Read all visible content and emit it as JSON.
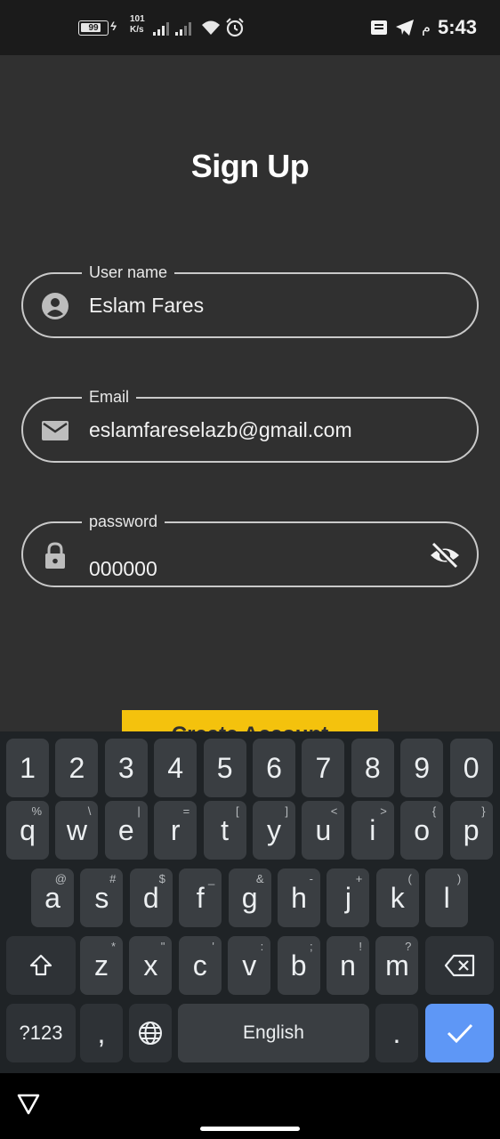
{
  "status_bar": {
    "battery": "99",
    "charge_symbol": "ϟ",
    "speed_value": "101",
    "speed_unit": "K/s",
    "arabic_ampm": "م",
    "time": "5:43"
  },
  "page": {
    "title": "Sign Up"
  },
  "form": {
    "username": {
      "label": "User name",
      "value": "Eslam Fares",
      "icon": "person-icon"
    },
    "email": {
      "label": "Email",
      "value": "eslamfareselazb@gmail.com",
      "icon": "mail-icon"
    },
    "password": {
      "label": "password",
      "value": "000000",
      "icon": "lock-icon",
      "toggle_icon": "eye-off-icon"
    }
  },
  "submit_button": {
    "label": "Create Account",
    "color": "#f4c20d"
  },
  "keyboard": {
    "row_numbers": [
      "1",
      "2",
      "3",
      "4",
      "5",
      "6",
      "7",
      "8",
      "9",
      "0"
    ],
    "row_q": [
      {
        "k": "q",
        "h": "%"
      },
      {
        "k": "w",
        "h": "\\"
      },
      {
        "k": "e",
        "h": "|"
      },
      {
        "k": "r",
        "h": "="
      },
      {
        "k": "t",
        "h": "["
      },
      {
        "k": "y",
        "h": "]"
      },
      {
        "k": "u",
        "h": "<"
      },
      {
        "k": "i",
        "h": ">"
      },
      {
        "k": "o",
        "h": "{"
      },
      {
        "k": "p",
        "h": "}"
      }
    ],
    "row_a": [
      {
        "k": "a",
        "h": "@"
      },
      {
        "k": "s",
        "h": "#"
      },
      {
        "k": "d",
        "h": "$"
      },
      {
        "k": "f",
        "h": "_"
      },
      {
        "k": "g",
        "h": "&"
      },
      {
        "k": "h",
        "h": "-"
      },
      {
        "k": "j",
        "h": "+"
      },
      {
        "k": "k",
        "h": "("
      },
      {
        "k": "l",
        "h": ")"
      }
    ],
    "row_z": [
      {
        "k": "z",
        "h": "*"
      },
      {
        "k": "x",
        "h": "\""
      },
      {
        "k": "c",
        "h": "'"
      },
      {
        "k": "v",
        "h": ":"
      },
      {
        "k": "b",
        "h": ";"
      },
      {
        "k": "n",
        "h": "!"
      },
      {
        "k": "m",
        "h": "?"
      }
    ],
    "symbols_key": "?123",
    "comma_key": ",",
    "space_label": "English",
    "period_key": ".",
    "enter_color": "#5e97f6"
  }
}
